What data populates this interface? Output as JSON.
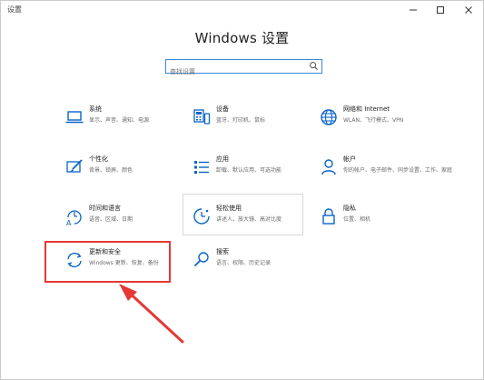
{
  "window": {
    "title": "设置",
    "minimize_icon": "minimize-icon",
    "maximize_icon": "maximize-icon",
    "close_icon": "close-icon"
  },
  "header": {
    "title": "Windows 设置"
  },
  "search": {
    "placeholder": "查找设置",
    "icon": "search-icon",
    "accent": "#3a8ad8"
  },
  "tiles": [
    {
      "title": "系统",
      "desc": "显示、声音、通知、电源",
      "icon": "laptop-icon"
    },
    {
      "title": "设备",
      "desc": "蓝牙、打印机、鼠标",
      "icon": "keyboard-device-icon"
    },
    {
      "title": "网络和 Internet",
      "desc": "WLAN、飞行模式、VPN",
      "icon": "globe-icon"
    },
    {
      "title": "个性化",
      "desc": "背景、锁屏、颜色",
      "icon": "paint-icon"
    },
    {
      "title": "应用",
      "desc": "卸载、默认应用、可选功能",
      "icon": "apps-list-icon"
    },
    {
      "title": "帐户",
      "desc": "你的帐户、电子邮件、同步设置、工作、家庭",
      "icon": "person-icon"
    },
    {
      "title": "时间和语言",
      "desc": "语音、区域、日期",
      "icon": "time-language-icon"
    },
    {
      "title": "轻松使用",
      "desc": "讲述人、放大镜、高对比度",
      "icon": "ease-of-access-icon"
    },
    {
      "title": "隐私",
      "desc": "位置、相机",
      "icon": "lock-icon"
    },
    {
      "title": "更新和安全",
      "desc": "Windows 更新、恢复、备份",
      "icon": "refresh-icon"
    },
    {
      "title": "搜索",
      "desc": "语言、权限、历史记录",
      "icon": "magnifier-icon"
    }
  ],
  "colors": {
    "icon_blue": "#0a64c8",
    "highlight_red": "#e53935"
  }
}
